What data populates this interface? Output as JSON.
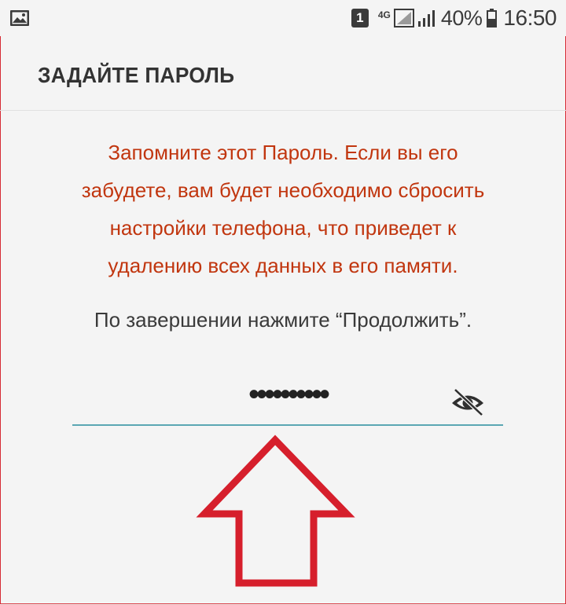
{
  "status_bar": {
    "sim": "1",
    "network_type": "4G",
    "battery_percent": "40%",
    "time": "16:50",
    "icons": [
      "gallery-icon",
      "signal-icon",
      "battery-icon"
    ]
  },
  "header": {
    "title": "ЗАДАЙТЕ ПАРОЛЬ"
  },
  "warning": {
    "lines": [
      "Запомните этот Пароль. Если вы его",
      "забудете, вам будет необходимо сбросить",
      "настройки телефона, что приведет к",
      "удалению всех данных в его памяти."
    ],
    "color": "#c1360f"
  },
  "instruction": "По завершении нажмите “Продолжить”.",
  "password": {
    "value": "••••••••••",
    "visibility_icon": "eye-off-icon",
    "underline_color": "#5aa6b3"
  },
  "annotation": {
    "arrow_color": "#d61f2c",
    "icon": "up-arrow-icon"
  }
}
